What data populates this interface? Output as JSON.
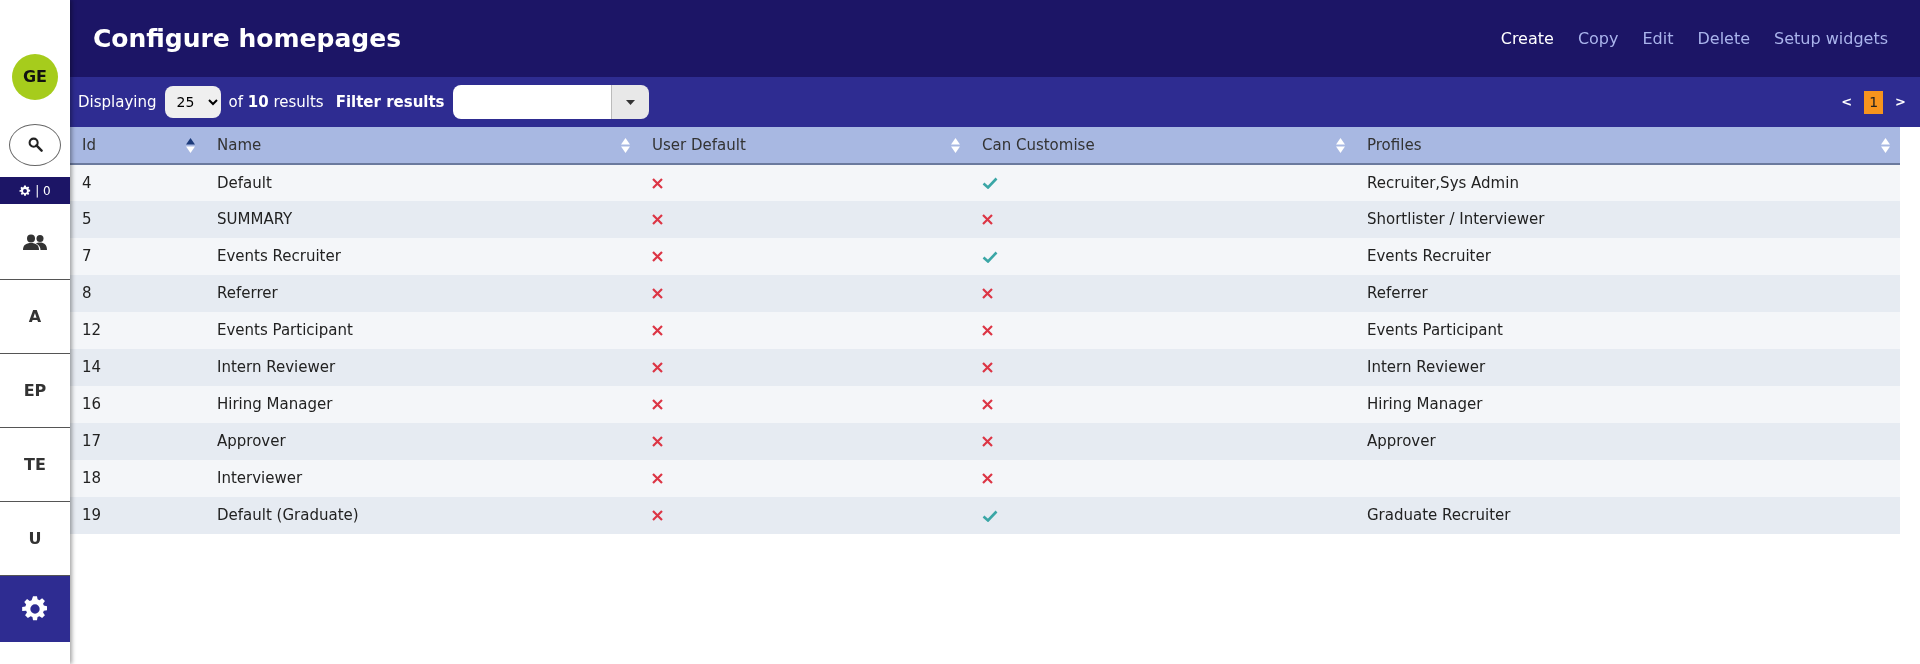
{
  "sidebar": {
    "items": [
      {
        "kind": "avatar",
        "label": "GE",
        "selected": false
      },
      {
        "kind": "search",
        "selected": false
      },
      {
        "kind": "counter",
        "label": "| 0",
        "selected": false
      },
      {
        "kind": "people",
        "selected": false
      },
      {
        "kind": "letter",
        "label": "A",
        "selected": false
      },
      {
        "kind": "letter",
        "label": "EP",
        "selected": false
      },
      {
        "kind": "letter",
        "label": "TE",
        "selected": false
      },
      {
        "kind": "letter",
        "label": "U",
        "selected": false
      },
      {
        "kind": "settings",
        "selected": true
      }
    ]
  },
  "header": {
    "title": "Configure homepages",
    "actions": [
      {
        "label": "Create",
        "disabled": false
      },
      {
        "label": "Copy",
        "disabled": true
      },
      {
        "label": "Edit",
        "disabled": true
      },
      {
        "label": "Delete",
        "disabled": true
      },
      {
        "label": "Setup widgets",
        "disabled": true
      }
    ]
  },
  "toolbar": {
    "displaying_label": "Displaying",
    "page_size": "25",
    "results_prefix": "of",
    "results_count": "10",
    "results_suffix": "results",
    "filter_label": "Filter results",
    "pagination": {
      "prev": "<",
      "pages": [
        {
          "label": "1",
          "selected": true
        }
      ],
      "next": ">"
    }
  },
  "table": {
    "columns": [
      {
        "label": "Id",
        "sorted": true
      },
      {
        "label": "Name",
        "sorted": false
      },
      {
        "label": "User Default",
        "sorted": false
      },
      {
        "label": "Can Customise",
        "sorted": false
      },
      {
        "label": "Profiles",
        "sorted": false
      }
    ],
    "rows": [
      {
        "id": "4",
        "name": "Default",
        "user_default": false,
        "can_customise": true,
        "profiles": "Recruiter,Sys Admin"
      },
      {
        "id": "5",
        "name": "SUMMARY",
        "user_default": false,
        "can_customise": false,
        "profiles": "Shortlister / Interviewer"
      },
      {
        "id": "7",
        "name": "Events Recruiter",
        "user_default": false,
        "can_customise": true,
        "profiles": "Events Recruiter"
      },
      {
        "id": "8",
        "name": "Referrer",
        "user_default": false,
        "can_customise": false,
        "profiles": "Referrer"
      },
      {
        "id": "12",
        "name": "Events Participant",
        "user_default": false,
        "can_customise": false,
        "profiles": "Events Participant"
      },
      {
        "id": "14",
        "name": "Intern Reviewer",
        "user_default": false,
        "can_customise": false,
        "profiles": "Intern Reviewer"
      },
      {
        "id": "16",
        "name": "Hiring Manager",
        "user_default": false,
        "can_customise": false,
        "profiles": "Hiring Manager"
      },
      {
        "id": "17",
        "name": "Approver",
        "user_default": false,
        "can_customise": false,
        "profiles": "Approver"
      },
      {
        "id": "18",
        "name": "Interviewer",
        "user_default": false,
        "can_customise": false
      },
      {
        "id": "19",
        "name": "Default (Graduate)",
        "user_default": false,
        "can_customise": true,
        "profiles": "Graduate Recruiter"
      }
    ]
  }
}
